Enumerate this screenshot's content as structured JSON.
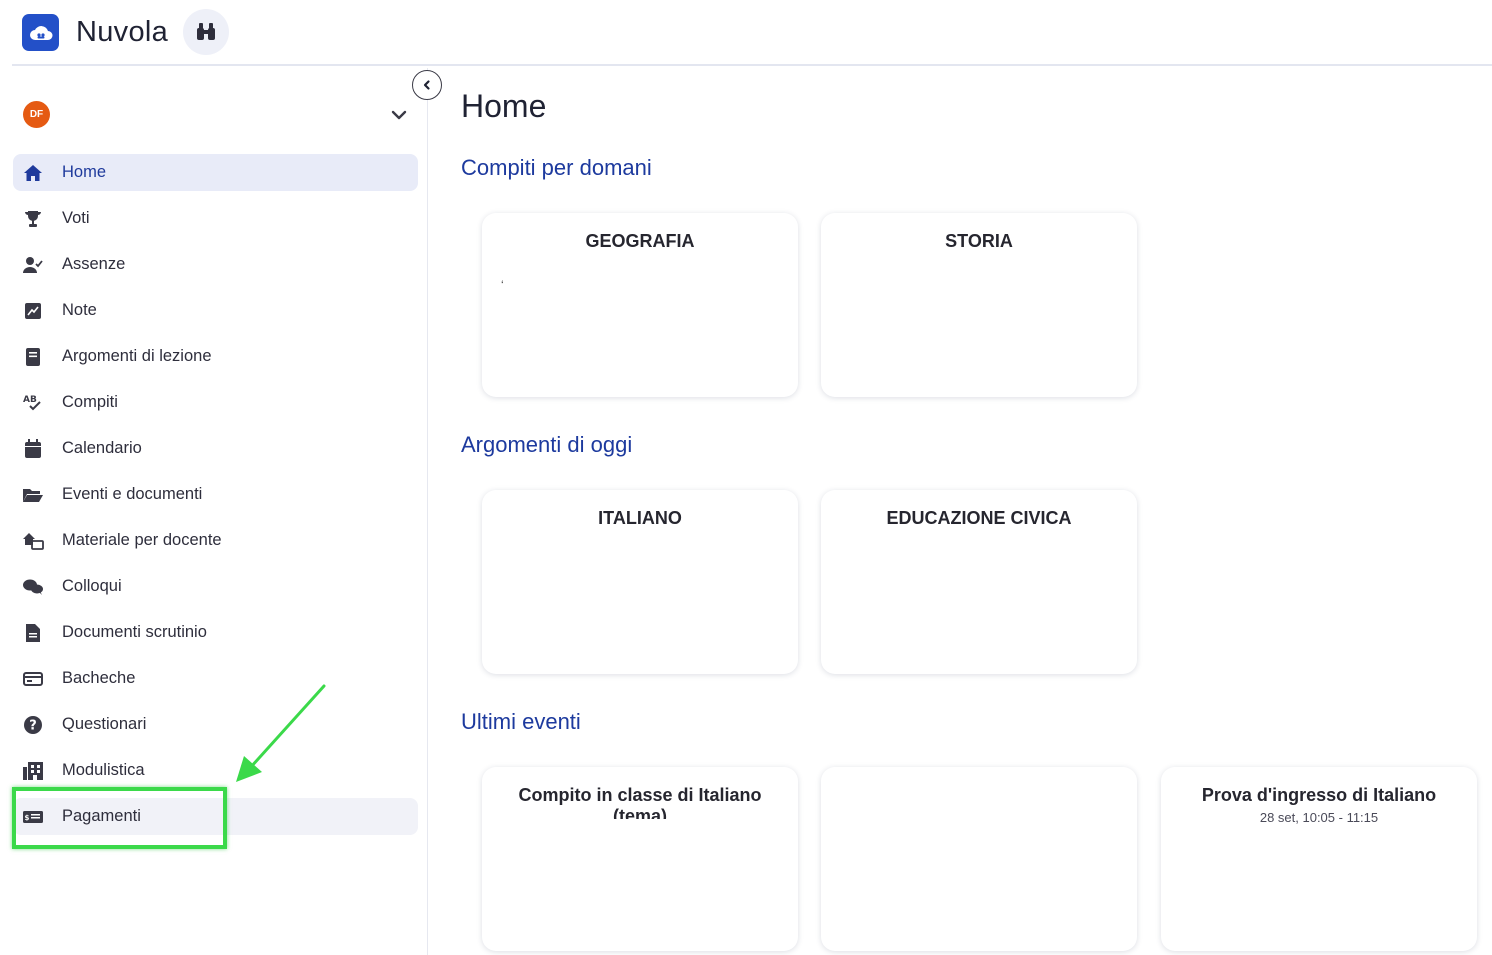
{
  "app": {
    "title": "Nuvola"
  },
  "user": {
    "initials": "DF"
  },
  "sidebar": {
    "items": [
      {
        "label": "Home",
        "icon": "home-icon"
      },
      {
        "label": "Voti",
        "icon": "trophy-icon"
      },
      {
        "label": "Assenze",
        "icon": "user-check-icon"
      },
      {
        "label": "Note",
        "icon": "note-icon"
      },
      {
        "label": "Argomenti di lezione",
        "icon": "book-icon"
      },
      {
        "label": "Compiti",
        "icon": "spellcheck-icon"
      },
      {
        "label": "Calendario",
        "icon": "calendar-icon"
      },
      {
        "label": "Eventi e documenti",
        "icon": "folder-open-icon"
      },
      {
        "label": "Materiale per docente",
        "icon": "house-share-icon"
      },
      {
        "label": "Colloqui",
        "icon": "comments-icon"
      },
      {
        "label": "Documenti scrutinio",
        "icon": "file-icon"
      },
      {
        "label": "Bacheche",
        "icon": "board-icon"
      },
      {
        "label": "Questionari",
        "icon": "question-circle-icon"
      },
      {
        "label": "Modulistica",
        "icon": "building-icon"
      },
      {
        "label": "Pagamenti",
        "icon": "money-card-icon"
      }
    ]
  },
  "main": {
    "title": "Home",
    "sections": [
      {
        "title": "Compiti per domani",
        "cards": [
          {
            "title": "GEOGRAFIA",
            "mark": "‘"
          },
          {
            "title": "STORIA"
          }
        ]
      },
      {
        "title": "Argomenti di oggi",
        "cards": [
          {
            "title": "ITALIANO"
          },
          {
            "title": "EDUCAZIONE CIVICA"
          }
        ]
      },
      {
        "title": "Ultimi eventi",
        "cards": [
          {
            "title": "Compito in classe di Italiano (tema)"
          },
          {
            "title": ""
          },
          {
            "title": "Prova d'ingresso di Italiano",
            "subtitle": "28 set, 10:05 - 11:15"
          }
        ]
      }
    ]
  },
  "colors": {
    "accent": "#1d3a9e",
    "logo": "#2350c8",
    "avatar": "#e55a12",
    "highlight": "#3bd94a"
  }
}
